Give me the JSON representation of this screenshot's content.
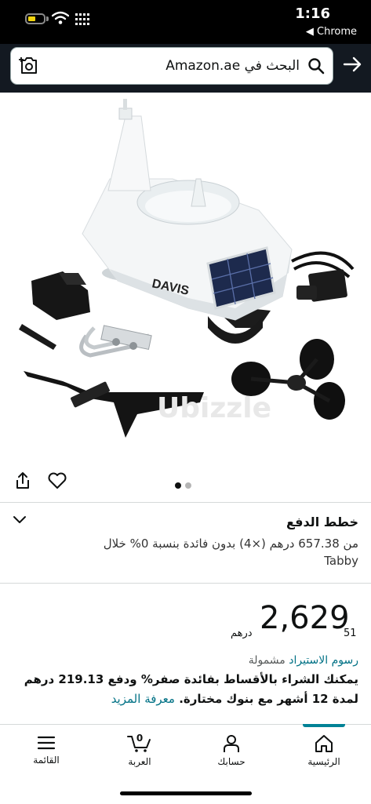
{
  "status_bar": {
    "time": "1:16",
    "back_app": "◀ Chrome"
  },
  "search": {
    "text": "البحث في Amazon.ae"
  },
  "product": {
    "watermark": "Ubizzle",
    "image_dots": 2,
    "active_dot": 0
  },
  "payment_plan": {
    "title": "خطط الدفع",
    "line1": "من 657.38 درهم (×4) بدون فائدة بنسبة 0% خلال",
    "line2": "Tabby"
  },
  "price": {
    "whole": "2,629",
    "fraction": "51",
    "currency": "درهم",
    "import_link": "رسوم الاستيراد",
    "import_suffix": "مشمولة",
    "installment_text": "يمكنك الشراء بالأقساط بفائدة صفر% ودفع 219.13 درهم لمدة 12 أشهر مع بنوك مختارة.",
    "learn_more": "معرفة المزيد"
  },
  "bottom_nav": {
    "home": "الرئيسية",
    "account": "حسابك",
    "cart": "العربة",
    "cart_count": "0",
    "menu": "القائمة"
  },
  "colors": {
    "header": "#131921",
    "link": "#007185",
    "accent": "#008296",
    "battery": "#f2d40e"
  }
}
